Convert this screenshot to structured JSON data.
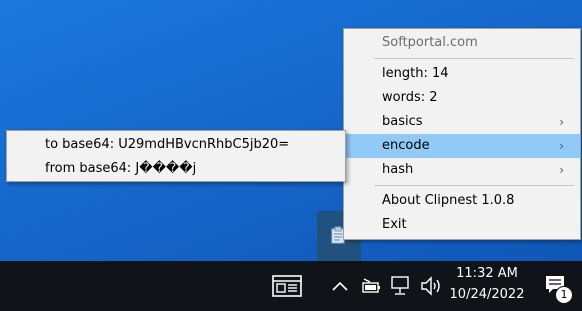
{
  "main_menu": {
    "items": [
      {
        "label": "Softportal.com",
        "disabled": true
      },
      {
        "label": "length: 14"
      },
      {
        "label": "words: 2"
      },
      {
        "label": "basics",
        "submenu": true
      },
      {
        "label": "encode",
        "submenu": true,
        "selected": true
      },
      {
        "label": "hash",
        "submenu": true
      },
      {
        "label": "About Clipnest 1.0.8"
      },
      {
        "label": "Exit"
      }
    ]
  },
  "submenu": {
    "items": [
      {
        "label": "to base64: U29mdHBvcnRhbC5jb20="
      },
      {
        "label": "from base64: J����j"
      }
    ]
  },
  "taskbar": {
    "time": "11:32 AM",
    "date": "10/24/2022",
    "notification_count": "1"
  },
  "icons": {
    "tray_app": "clipboard-icon",
    "news": "news-icon",
    "chevron": "chevron-up-icon",
    "battery": "battery-icon",
    "network": "network-icon",
    "volume": "volume-icon",
    "notifications": "notification-icon"
  },
  "colors": {
    "desktop": "#1565c8",
    "menu_bg": "#f2f2f2",
    "menu_selected": "#91c9f7",
    "taskbar": "#101419",
    "tray_icon_highlight": "#21527f"
  }
}
